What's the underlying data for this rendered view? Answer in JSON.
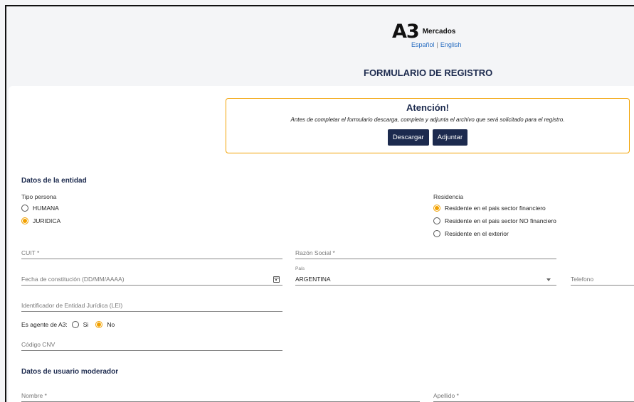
{
  "header": {
    "logo_main": "A3",
    "logo_sub": "Mercados",
    "lang_es": "Español",
    "lang_en": "English",
    "title": "FORMULARIO DE REGISTRO"
  },
  "alert": {
    "title": "Atención!",
    "text": "Antes de completar el formulario descarga, completa y adjunta el archivo que será solicitado para el registro.",
    "download_label": "Descargar",
    "attach_label": "Adjuntar",
    "border_color": "#f2a100"
  },
  "entity": {
    "section_title": "Datos de la entidad",
    "tipo_persona": {
      "label": "Tipo persona",
      "options": [
        "HUMANA",
        "JURIDICA"
      ],
      "selected": "JURIDICA"
    },
    "residencia": {
      "label": "Residencia",
      "options": [
        "Residente en el pais sector financiero",
        "Residente en el pais sector NO financiero",
        "Residente en el exterior"
      ],
      "selected": "Residente en el pais sector financiero"
    },
    "fields": {
      "cuit": "CUIT *",
      "razon_social": "Razón Social *",
      "fecha": "Fecha de constitución (DD/MM/AAAA)",
      "pais_label": "País",
      "pais_value": "ARGENTINA",
      "telefono": "Telefono",
      "lei": "Identificador de Entidad Jurídica (LEI)",
      "codigo_cnv": "Código CNV"
    },
    "agente": {
      "label": "Es agente de A3:",
      "yes": "Si",
      "no": "No",
      "selected": "No"
    }
  },
  "moderator": {
    "section_title": "Datos de usuario moderador",
    "nombre": "Nombre *",
    "apellido": "Apellido *"
  },
  "colors": {
    "brand_navy": "#1c2a4e",
    "accent_orange": "#f2a100",
    "link_blue": "#2a6fc2"
  }
}
